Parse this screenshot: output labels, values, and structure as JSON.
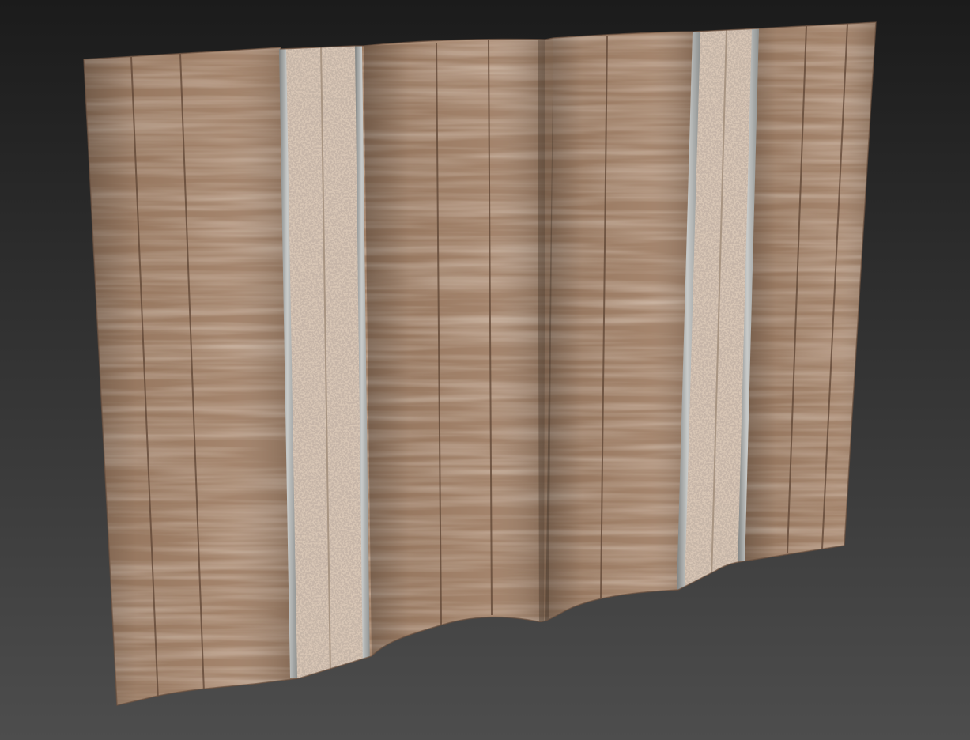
{
  "scene": {
    "subject": "3d-render",
    "background_top": "#1b1b1b",
    "background_bottom": "#4d4d4d",
    "materials": {
      "wood_base": "#9d7b62",
      "wood_light": "#b08f74",
      "wood_dark": "#7e5f49",
      "wood_groove": "#5a4232",
      "terrazzo_base": "#d9c8b8",
      "terrazzo_speck_dark": "#9e8470",
      "terrazzo_speck_light": "#efe3d6",
      "metal_strip": "#b5b7b6",
      "metal_strip_dark": "#7f8281"
    }
  }
}
